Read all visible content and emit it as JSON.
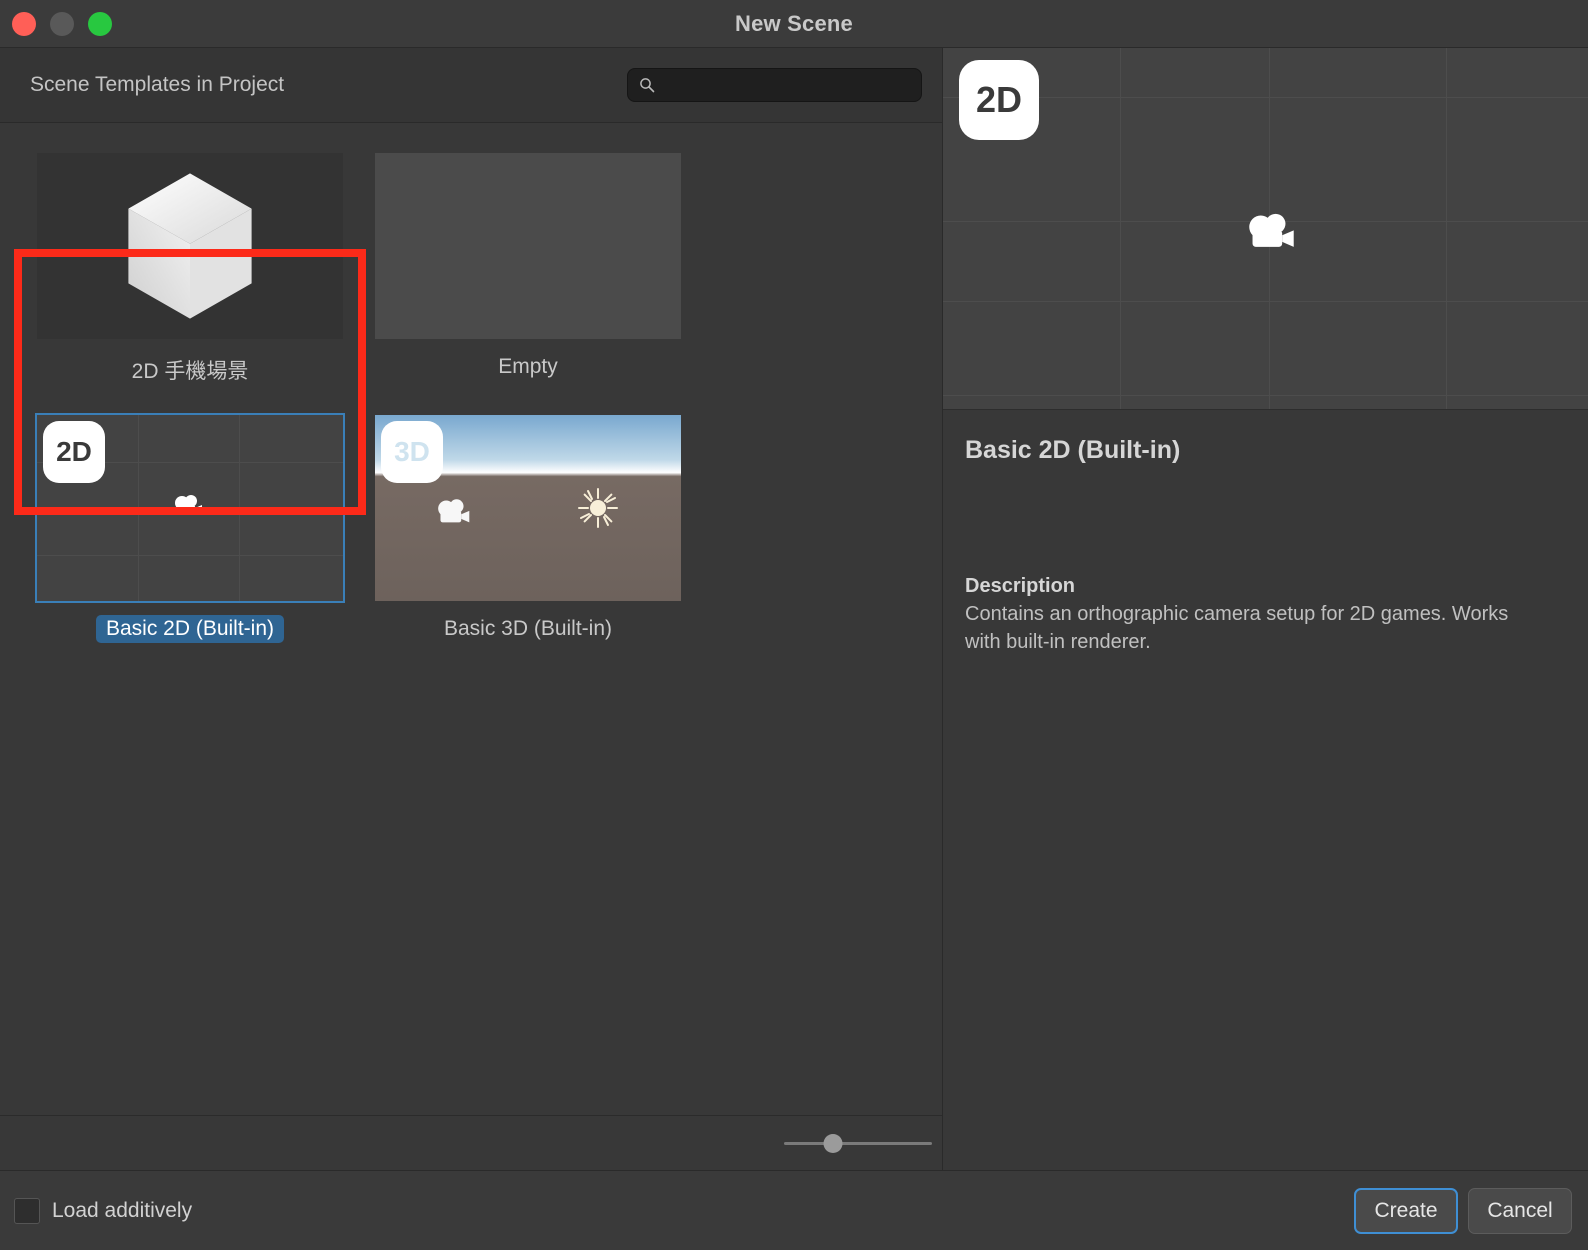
{
  "window": {
    "title": "New Scene",
    "traffic_lights": [
      "close-button",
      "minimize-button",
      "maximize-button"
    ]
  },
  "list_panel": {
    "header_title": "Scene Templates in Project",
    "search": {
      "value": "",
      "placeholder": "",
      "icon": "search-icon"
    },
    "templates": [
      {
        "label": "2D 手機場景",
        "thumb": "unity-logo",
        "selected": false,
        "annotated": true
      },
      {
        "label": "Empty",
        "thumb": "empty",
        "selected": false,
        "annotated": false
      },
      {
        "label": "Basic 2D (Built-in)",
        "thumb": "grid-2d",
        "badge": "2D",
        "selected": true,
        "annotated": false
      },
      {
        "label": "Basic 3D (Built-in)",
        "thumb": "scene-3d",
        "badge": "3D",
        "selected": false,
        "annotated": false
      }
    ],
    "size_slider": {
      "name": "thumbnail-size-slider",
      "value": 33
    }
  },
  "preview_panel": {
    "badge": "2D",
    "title": "Basic 2D (Built-in)",
    "description_heading": "Description",
    "description_body": "Contains an orthographic camera setup for 2D games. Works with built-in renderer."
  },
  "footer": {
    "load_additively_label": "Load additively",
    "load_additively_checked": false,
    "create_label": "Create",
    "cancel_label": "Cancel"
  },
  "annotation": {
    "color": "#fc2a19",
    "target": "2D 手機場景"
  },
  "colors": {
    "window_bg": "#383838",
    "titlebar_bg": "#3b3b3b",
    "selection_blue": "#2f6593",
    "focus_blue": "#3f8fd4",
    "annotation_red": "#fc2a19"
  }
}
